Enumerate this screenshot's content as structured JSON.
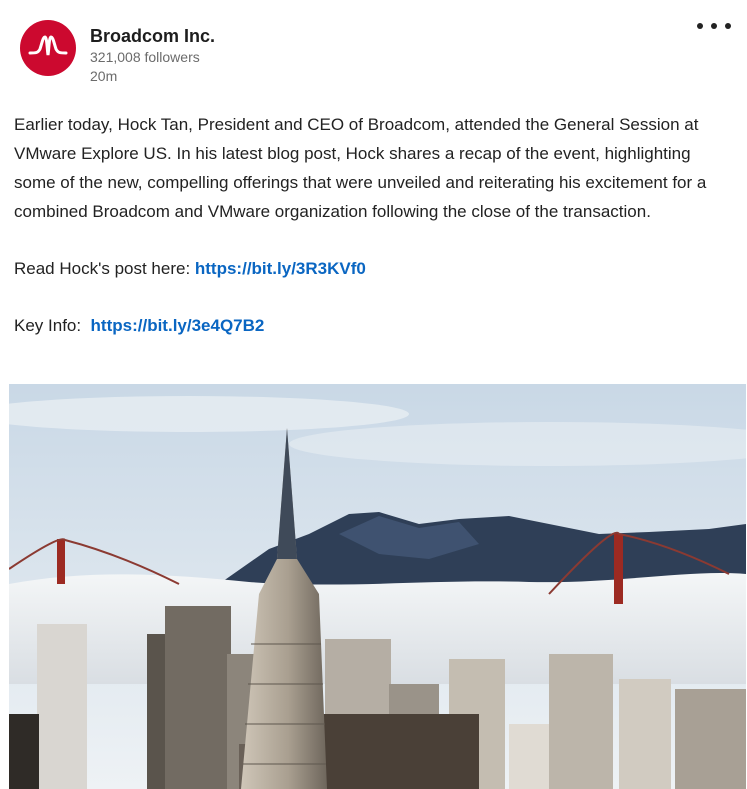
{
  "post": {
    "author": "Broadcom Inc.",
    "followers": "321,008 followers",
    "time": "20m",
    "body": "Earlier today, Hock Tan, President and CEO of Broadcom, attended the General Session at VMware Explore US. In his latest blog post, Hock shares a recap of the event, highlighting some of the new, compelling offerings that were unveiled and reiterating his excitement for a combined Broadcom and VMware organization following the close of the transaction.",
    "read_label": "Read Hock's post here: ",
    "read_link": "https://bit.ly/3R3KVf0",
    "key_label": "Key Info:  ",
    "key_link": "https://bit.ly/3e4Q7B2"
  },
  "icons": {
    "logo": "broadcom-logo-icon",
    "more": "more-options-icon"
  },
  "colors": {
    "brand_red": "#cc092f",
    "link_blue": "#0a66c2"
  }
}
